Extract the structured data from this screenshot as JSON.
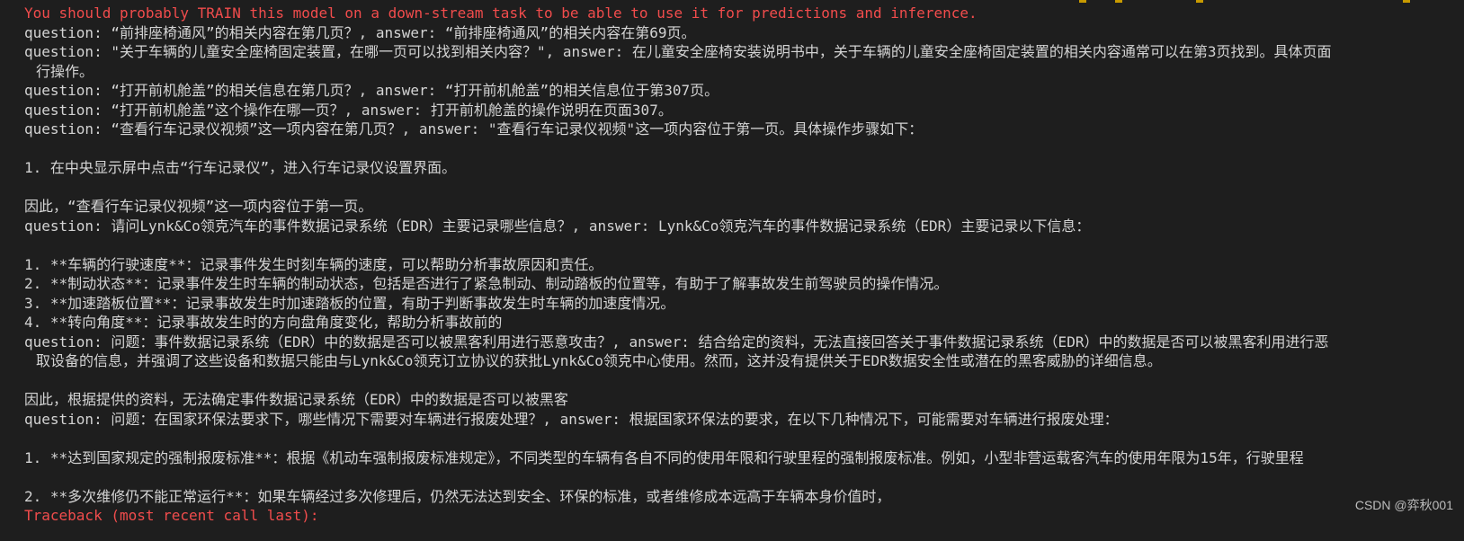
{
  "terminal": {
    "lines": [
      {
        "text": "You should probably TRAIN this model on a down-stream task to be able to use it for predictions and inference.",
        "style": "warn"
      },
      {
        "text": "question: “前排座椅通风”的相关内容在第几页？, answer: “前排座椅通风”的相关内容在第69页。",
        "style": "normal"
      },
      {
        "text": "question: \"关于车辆的儿童安全座椅固定装置，在哪一页可以找到相关内容？\", answer: 在儿童安全座椅安装说明书中，关于车辆的儿童安全座椅固定装置的相关内容通常可以在第3页找到。具体页面",
        "style": "normal"
      },
      {
        "text": "行操作。",
        "style": "normal",
        "indent": true
      },
      {
        "text": "question: “打开前机舱盖”的相关信息在第几页？, answer: “打开前机舱盖”的相关信息位于第307页。",
        "style": "normal"
      },
      {
        "text": "question: “打开前机舱盖”这个操作在哪一页？, answer: 打开前机舱盖的操作说明在页面307。",
        "style": "normal"
      },
      {
        "text": "question: “查看行车记录仪视频”这一项内容在第几页？, answer: \"查看行车记录仪视频\"这一项内容位于第一页。具体操作步骤如下：",
        "style": "normal"
      },
      {
        "text": "",
        "style": "normal"
      },
      {
        "text": "1. 在中央显示屏中点击“行车记录仪”，进入行车记录仪设置界面。",
        "style": "normal"
      },
      {
        "text": "",
        "style": "normal"
      },
      {
        "text": "因此，“查看行车记录仪视频”这一项内容位于第一页。",
        "style": "normal"
      },
      {
        "text": "question: 请问Lynk&Co领克汽车的事件数据记录系统（EDR）主要记录哪些信息？, answer: Lynk&Co领克汽车的事件数据记录系统（EDR）主要记录以下信息：",
        "style": "normal"
      },
      {
        "text": "",
        "style": "normal"
      },
      {
        "text": "1. **车辆的行驶速度**：记录事件发生时刻车辆的速度，可以帮助分析事故原因和责任。",
        "style": "normal"
      },
      {
        "text": "2. **制动状态**：记录事件发生时车辆的制动状态，包括是否进行了紧急制动、制动踏板的位置等，有助于了解事故发生前驾驶员的操作情况。",
        "style": "normal"
      },
      {
        "text": "3. **加速踏板位置**：记录事故发生时加速踏板的位置，有助于判断事故发生时车辆的加速度情况。",
        "style": "normal"
      },
      {
        "text": "4. **转向角度**：记录事故发生时的方向盘角度变化，帮助分析事故前的",
        "style": "normal"
      },
      {
        "text": "question: 问题：事件数据记录系统（EDR）中的数据是否可以被黑客利用进行恶意攻击？, answer: 结合给定的资料，无法直接回答关于事件数据记录系统（EDR）中的数据是否可以被黑客利用进行恶",
        "style": "normal"
      },
      {
        "text": "取设备的信息，并强调了这些设备和数据只能由与Lynk&Co领克订立协议的获批Lynk&Co领克中心使用。然而，这并没有提供关于EDR数据安全性或潜在的黑客威胁的详细信息。",
        "style": "normal",
        "indent": true
      },
      {
        "text": "",
        "style": "normal"
      },
      {
        "text": "因此，根据提供的资料，无法确定事件数据记录系统（EDR）中的数据是否可以被黑客",
        "style": "normal"
      },
      {
        "text": "question: 问题：在国家环保法要求下，哪些情况下需要对车辆进行报废处理？, answer: 根据国家环保法的要求，在以下几种情况下，可能需要对车辆进行报废处理：",
        "style": "normal"
      },
      {
        "text": "",
        "style": "normal"
      },
      {
        "text": "1. **达到国家规定的强制报废标准**：根据《机动车强制报废标准规定》，不同类型的车辆有各自不同的使用年限和行驶里程的强制报废标准。例如，小型非营运载客汽车的使用年限为15年，行驶里程",
        "style": "normal"
      },
      {
        "text": "",
        "style": "normal"
      },
      {
        "text": "2. **多次维修仍不能正常运行**：如果车辆经过多次修理后，仍然无法达到安全、环保的标准，或者维修成本远高于车辆本身价值时，",
        "style": "normal"
      },
      {
        "text": "Traceback (most recent call last):",
        "style": "warn"
      }
    ]
  },
  "watermark": {
    "text": "CSDN @弈秋001"
  }
}
